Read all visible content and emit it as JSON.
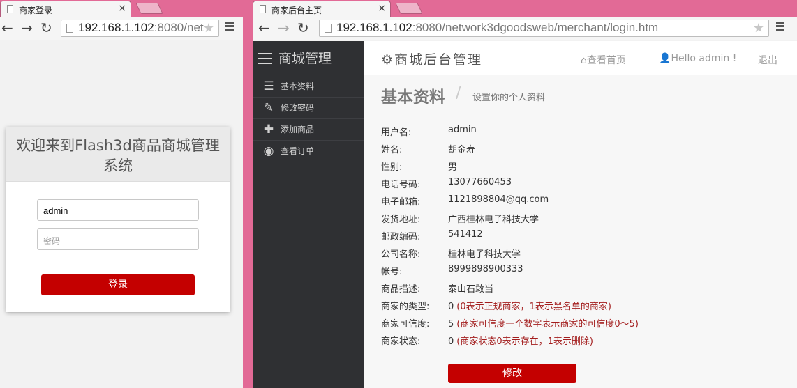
{
  "left_window": {
    "tab_title": "商家登录",
    "tab_close": "×",
    "url_host": "192.168.1.102",
    "url_rest": ":8080/net",
    "login": {
      "heading": "欢迎来到Flash3d商品商城管理系统",
      "username_value": "admin",
      "password_placeholder": "密码",
      "submit_label": "登录"
    }
  },
  "right_window": {
    "tab_title": "商家后台主页",
    "tab_close": "×",
    "url_host": "192.168.1.102",
    "url_rest": ":8080/network3dgoodsweb/merchant/login.htm",
    "sidebar": {
      "brand": "商城管理",
      "items": [
        {
          "label": "基本资料",
          "icon": "list-icon"
        },
        {
          "label": "修改密码",
          "icon": "pencil-icon"
        },
        {
          "label": "添加商品",
          "icon": "plus-icon"
        },
        {
          "label": "查看订单",
          "icon": "eye-icon"
        }
      ]
    },
    "topbar": {
      "title": "商城后台管理",
      "home_link": "查看首页",
      "user_link": "Hello admin !",
      "logout_link": "退出"
    },
    "page": {
      "title": "基本资料",
      "subtitle": "设置你的个人资料"
    },
    "profile": [
      {
        "label": "用户名:",
        "value": "admin",
        "note": ""
      },
      {
        "label": "姓名:",
        "value": "胡金寿",
        "note": ""
      },
      {
        "label": "性别:",
        "value": "男",
        "note": ""
      },
      {
        "label": "电话号码:",
        "value": "13077660453",
        "note": ""
      },
      {
        "label": "电子邮箱:",
        "value": "1121898804@qq.com",
        "note": ""
      },
      {
        "label": "发货地址:",
        "value": "广西桂林电子科技大学",
        "note": ""
      },
      {
        "label": "邮政编码:",
        "value": "541412",
        "note": ""
      },
      {
        "label": "公司名称:",
        "value": "桂林电子科技大学",
        "note": ""
      },
      {
        "label": "帐号:",
        "value": "8999898900333",
        "note": ""
      },
      {
        "label": "商品描述:",
        "value": "泰山石敢当",
        "note": ""
      },
      {
        "label": "商家的类型:",
        "value": "0",
        "note": "(0表示正规商家，1表示黑名单的商家)"
      },
      {
        "label": "商家可信度:",
        "value": "5",
        "note": "(商家可信度一个数字表示商家的可信度0～5)"
      },
      {
        "label": "商家状态:",
        "value": "0",
        "note": "(商家状态0表示存在，1表示删除)"
      }
    ],
    "edit_label": "修改"
  },
  "colors": {
    "accent": "#c40000",
    "sidebar": "#2f3033",
    "desktop": "#e26a96",
    "note": "#a31d1d"
  }
}
